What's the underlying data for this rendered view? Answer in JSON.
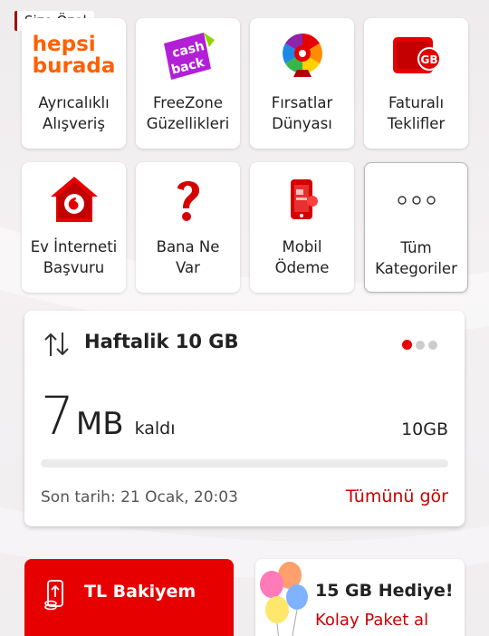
{
  "section_tag": "Size Özel",
  "tiles": [
    {
      "label": "Ayrıcalıklı\nAlışveriş",
      "icon": "hepsiburada-logo",
      "logo_line1": "hepsi",
      "logo_line2": "burada"
    },
    {
      "label": "FreeZone\nGüzellikleri",
      "icon": "cashback-icon",
      "logo_line1": "cash",
      "logo_line2": "back"
    },
    {
      "label": "Fırsatlar\nDünyası",
      "icon": "prize-wheel-icon"
    },
    {
      "label": "Faturalı\nTeklifler",
      "icon": "phone-gb-icon",
      "badge": "GB"
    },
    {
      "label": "Ev İnterneti\nBaşvuru",
      "icon": "home-vodafone-icon"
    },
    {
      "label": "Bana Ne\nVar",
      "icon": "question-mark-icon"
    },
    {
      "label": "Mobil\nÖdeme",
      "icon": "mobile-payment-icon"
    },
    {
      "label": "Tüm\nKategoriler",
      "icon": "more-dots-icon"
    }
  ],
  "usage_card": {
    "title": "Haftalik 10 GB",
    "remaining_value": "7",
    "remaining_unit": "MB",
    "remaining_suffix": "kaldı",
    "total": "10GB",
    "used_fraction": 0.0,
    "due": "Son tarih: 21 Ocak, 20:03",
    "see_all": "Tümünü gör",
    "page_count": 3,
    "active_page": 1
  },
  "bottom_cards": {
    "balance_title": "TL Bakiyem",
    "gift_title": "15 GB Hediye!",
    "gift_subtitle": "Kolay Paket al"
  },
  "colors": {
    "brand_red": "#e60000",
    "link_red": "#cc0000"
  }
}
